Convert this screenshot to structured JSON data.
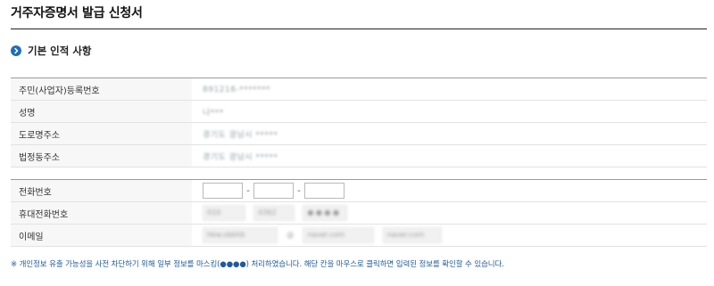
{
  "page": {
    "title": "거주자증명서 발급 신청서"
  },
  "section": {
    "title": "기본 인적 사항"
  },
  "basic_info": [
    {
      "label": "주민(사업자)등록번호",
      "value": "891218-*******"
    },
    {
      "label": "성명",
      "value": "나***"
    },
    {
      "label": "도로명주소",
      "value": "경기도 광남시 *****"
    },
    {
      "label": "법정동주소",
      "value": "경기도 광남시 *****"
    }
  ],
  "contact": {
    "phone_label": "전화번호",
    "phone_separator": "-",
    "mobile_label": "휴대전화번호",
    "mobile_values": [
      "010",
      "0362",
      "● ● ● ●"
    ],
    "email_label": "이메일",
    "email_values": [
      "hkw.sbbhb",
      "@",
      "naver.com",
      "naver.com"
    ]
  },
  "notice": "※ 개인정보 유출 가능성을 사전 차단하기 위해 일부 정보를 마스킹(●●●●) 처리하였습니다. 해당 칸을 마우스로 클릭하면 입력된 정보를 확인할 수 있습니다."
}
